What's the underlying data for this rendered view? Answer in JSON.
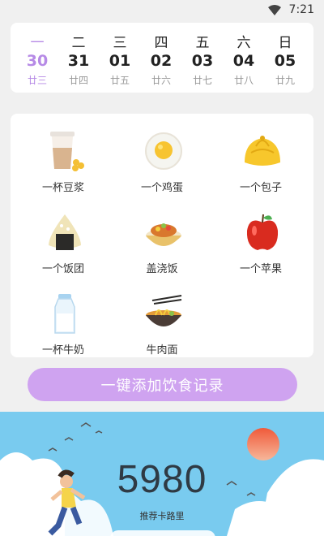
{
  "status": {
    "time": "7:21"
  },
  "calendar": {
    "days": [
      {
        "weekday": "一",
        "date": "30",
        "lunar": "廿三",
        "selected": true
      },
      {
        "weekday": "二",
        "date": "31",
        "lunar": "廿四"
      },
      {
        "weekday": "三",
        "date": "01",
        "lunar": "廿五"
      },
      {
        "weekday": "四",
        "date": "02",
        "lunar": "廿六"
      },
      {
        "weekday": "五",
        "date": "03",
        "lunar": "廿七"
      },
      {
        "weekday": "六",
        "date": "04",
        "lunar": "廿八"
      },
      {
        "weekday": "日",
        "date": "05",
        "lunar": "廿九"
      }
    ]
  },
  "foods": [
    {
      "label": "一杯豆浆",
      "icon": "soy-milk-icon"
    },
    {
      "label": "一个鸡蛋",
      "icon": "egg-icon"
    },
    {
      "label": "一个包子",
      "icon": "bun-icon"
    },
    {
      "label": "一个饭团",
      "icon": "rice-ball-icon"
    },
    {
      "label": "盖浇饭",
      "icon": "rice-bowl-icon"
    },
    {
      "label": "一个苹果",
      "icon": "apple-icon"
    },
    {
      "label": "一杯牛奶",
      "icon": "milk-icon"
    },
    {
      "label": "牛肉面",
      "icon": "noodle-icon"
    }
  ],
  "add_button": {
    "label": "一键添加饮食记录"
  },
  "banner": {
    "calories": "5980",
    "calories_label": "推荐卡路里"
  },
  "colors": {
    "accent": "#cfa3f0",
    "selected_day": "#b68ae6",
    "banner_sky": "#79cbef"
  }
}
